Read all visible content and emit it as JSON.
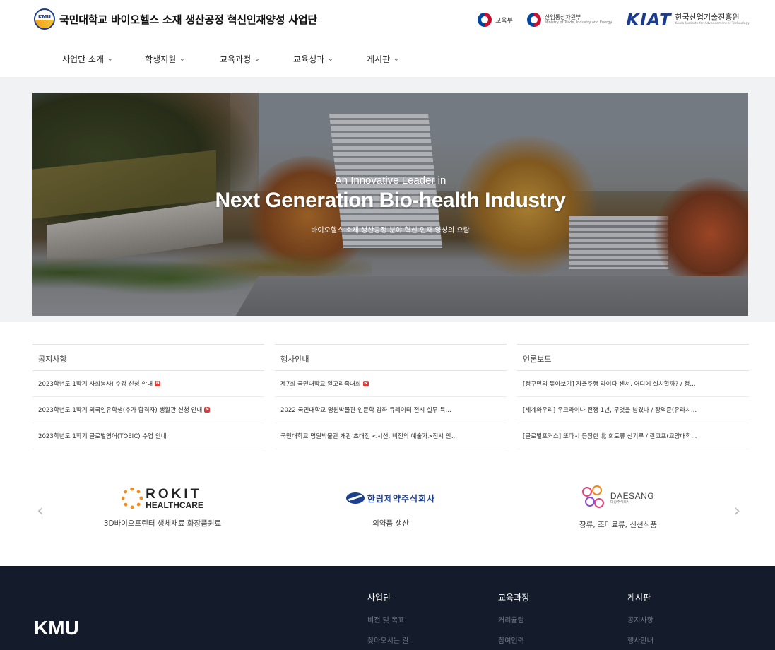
{
  "header": {
    "logo_text": "KMU",
    "title": "국민대학교 바이오헬스 소재 생산공정 혁신인재양성 사업단",
    "partners": {
      "moe": "교육부",
      "motie": "산업통상자원부",
      "motie_en": "Ministry of Trade, Industry and Energy",
      "kiat_logo": "KIAT",
      "kiat": "한국산업기술진흥원",
      "kiat_en": "Korea Institute for Advancement of Technology"
    }
  },
  "nav": {
    "items": [
      {
        "label": "사업단 소개"
      },
      {
        "label": "학생지원"
      },
      {
        "label": "교육과정"
      },
      {
        "label": "교육성과"
      },
      {
        "label": "게시판"
      }
    ]
  },
  "hero": {
    "kicker": "An Innovative Leader in",
    "title": "Next Generation Bio-health Industry",
    "subtitle": "바이오헬스 소재 생산공정 분야 혁신 인재 양성의 요람"
  },
  "boards": [
    {
      "title": "공지사항",
      "items": [
        {
          "text": "2023학년도 1학기 사회봉사Ⅰ 수강 신청 안내",
          "new": true
        },
        {
          "text": "2023학년도 1학기 외국인유학생(추가 합격자) 생활관 신청 안내",
          "new": true
        },
        {
          "text": "2023학년도 1학기 글로벌영어(TOEIC) 수업 안내",
          "new": false
        }
      ]
    },
    {
      "title": "행사안내",
      "items": [
        {
          "text": "제7회 국민대학교 알고리즘대회",
          "new": true
        },
        {
          "text": "2022 국민대학교 명원박물관 인문학 강좌 큐레이터 전시 실무 특...",
          "new": false
        },
        {
          "text": "국민대학교 명원박물관 개관 초대전 <시선, 비전의 예술가>전시 안...",
          "new": false
        }
      ]
    },
    {
      "title": "언론보도",
      "items": [
        {
          "text": "[정구민의 톺아보기] 자율주행 라이다 센서, 어디에 설치할까? / 정...",
          "new": false
        },
        {
          "text": "[세계와우리] 우크라이나 전쟁 1년, 무엇을 남겼나 / 장덕준(유라시...",
          "new": false
        },
        {
          "text": "[글로벌포커스] 또다시 등장한 北 회토류 신기루 / 란코프(교양대학...",
          "new": false
        }
      ]
    }
  ],
  "new_badge": "N",
  "partners_carousel": {
    "prev": "‹",
    "next": "›",
    "companies": [
      {
        "logo_line1": "ROKIT",
        "logo_line2": "HEALTHCARE",
        "caption": "3D바이오프린터 생체재료 화장품원료"
      },
      {
        "logo_line1": "한림제약주식회사",
        "caption": "의약품 생산"
      },
      {
        "logo_line1": "DAESANG",
        "logo_line2": "대상주식회사",
        "caption": "장류, 조미료류, 신선식품"
      }
    ]
  },
  "footer": {
    "logo": "KMU",
    "columns": [
      {
        "heading": "사업단",
        "links": [
          "비전 및 목표",
          "찾아오시는 길"
        ]
      },
      {
        "heading": "교육과정",
        "links": [
          "커리큘럼",
          "참여인력"
        ]
      },
      {
        "heading": "게시판",
        "links": [
          "공지사항",
          "행사안내"
        ]
      }
    ]
  }
}
